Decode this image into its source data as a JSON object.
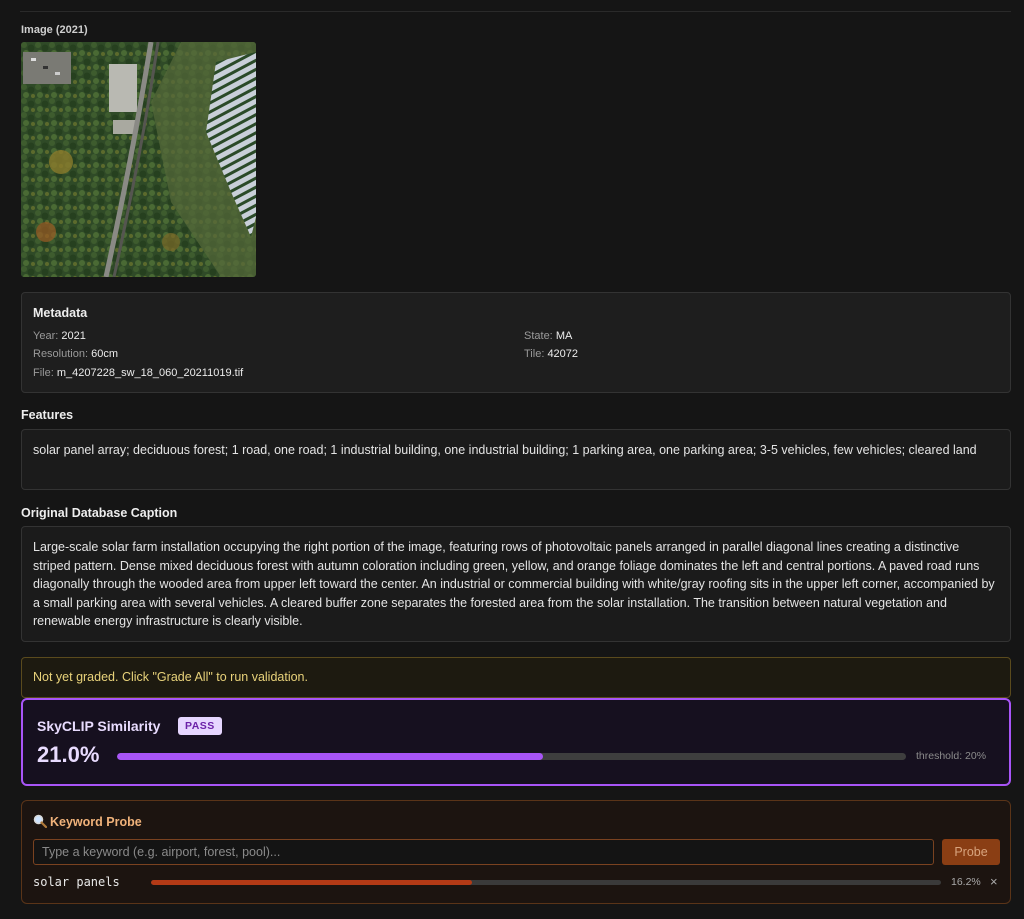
{
  "image": {
    "label": "Image (2021)",
    "alt": "aerial image"
  },
  "metadata": {
    "title": "Metadata",
    "year_label": "Year:",
    "year_value": "2021",
    "resolution_label": "Resolution:",
    "resolution_value": "60cm",
    "file_label": "File:",
    "file_value": "m_4207228_sw_18_060_20211019.tif",
    "state_label": "State:",
    "state_value": "MA",
    "tile_label": "Tile:",
    "tile_value": "42072"
  },
  "features": {
    "title": "Features",
    "text": "solar panel array; deciduous forest; 1 road, one road; 1 industrial building, one industrial building; 1 parking area, one parking area; 3-5 vehicles, few vehicles; cleared land"
  },
  "caption": {
    "title": "Original Database Caption",
    "text": "Large-scale solar farm installation occupying the right portion of the image, featuring rows of photovoltaic panels arranged in parallel diagonal lines creating a distinctive striped pattern. Dense mixed deciduous forest with autumn coloration including green, yellow, and orange foliage dominates the left and central portions. A paved road runs diagonally through the wooded area from upper left toward the center. An industrial or commercial building with white/gray roofing sits in the upper left corner, accompanied by a small parking area with several vehicles. A cleared buffer zone separates the forested area from the solar installation. The transition between natural vegetation and renewable energy infrastructure is clearly visible."
  },
  "grade_notice": "Not yet graded. Click \"Grade All\" to run validation.",
  "skyclip": {
    "title": "SkyCLIP Similarity",
    "badge": "PASS",
    "value_text": "21.0%",
    "value": 0.21,
    "bar_fraction": 0.54,
    "threshold_text": "threshold: 20%",
    "accent_color": "#a855f7"
  },
  "probe": {
    "title": "Keyword Probe",
    "title_icon": "magnifier-icon",
    "input_placeholder": "Type a keyword (e.g. airport, forest, pool)...",
    "input_value": "",
    "button_label": "Probe",
    "accent_color": "#b33a16",
    "results": [
      {
        "term": "solar panels",
        "value_text": "16.2%",
        "value": 0.162,
        "bar_fraction": 0.406,
        "remove_glyph": "×"
      }
    ]
  }
}
